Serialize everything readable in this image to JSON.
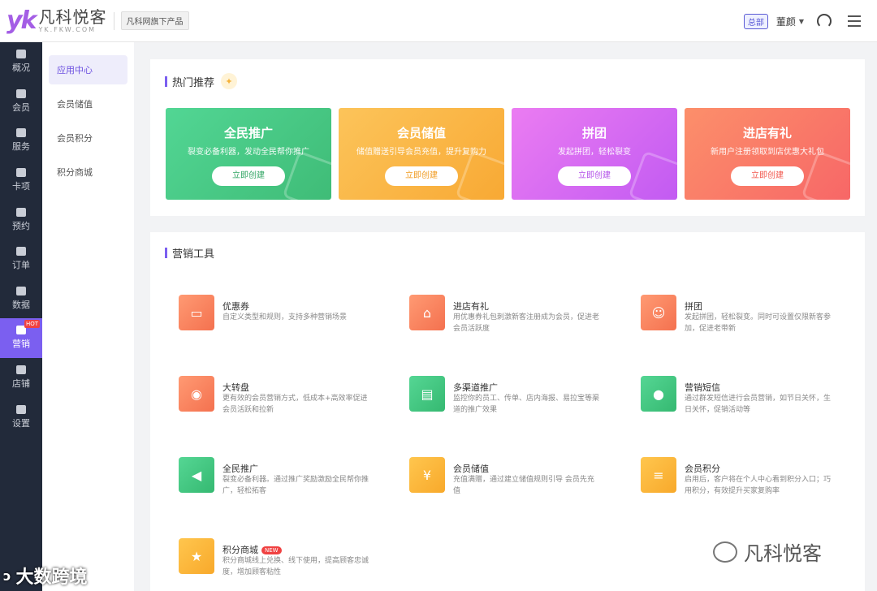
{
  "header": {
    "logo_mark": "yk",
    "logo_name": "凡科悦客",
    "logo_url": "YK.FKW.COM",
    "product_tag": "凡科网旗下产品",
    "store_badge": "总部",
    "user_name": "董颜"
  },
  "sidebar": {
    "items": [
      {
        "label": "概况"
      },
      {
        "label": "会员"
      },
      {
        "label": "服务"
      },
      {
        "label": "卡项"
      },
      {
        "label": "预约"
      },
      {
        "label": "订单"
      },
      {
        "label": "数据"
      },
      {
        "label": "营销",
        "badge": "HOT",
        "active": true
      },
      {
        "label": "店铺"
      },
      {
        "label": "设置"
      }
    ]
  },
  "subnav": {
    "items": [
      {
        "label": "应用中心",
        "active": true
      },
      {
        "label": "会员储值"
      },
      {
        "label": "会员积分"
      },
      {
        "label": "积分商城"
      }
    ]
  },
  "hot": {
    "title": "热门推荐",
    "cards": [
      {
        "title": "全民推广",
        "subtitle": "裂变必备利器，发动全民帮你推广",
        "button": "立即创建"
      },
      {
        "title": "会员储值",
        "subtitle": "储值赠送引导会员充值，提升复购力",
        "button": "立即创建"
      },
      {
        "title": "拼团",
        "subtitle": "发起拼团，轻松裂变",
        "button": "立即创建"
      },
      {
        "title": "进店有礼",
        "subtitle": "新用户注册领取到店优惠大礼包",
        "button": "立即创建"
      }
    ]
  },
  "tools": {
    "title": "营销工具",
    "items": [
      {
        "name": "优惠券",
        "desc": "自定义类型和规则，支持多种营销场景",
        "icon": "ticket-icon",
        "color": "#f4714f"
      },
      {
        "name": "进店有礼",
        "desc": "用优惠券礼包刺激新客注册成为会员，促进老会员活跃度",
        "icon": "gift-store-icon",
        "color": "#f4714f"
      },
      {
        "name": "拼团",
        "desc": "发起拼团，轻松裂变。同时可设置仅限新客参加，促进老带新",
        "icon": "group-icon",
        "color": "#f4714f"
      },
      {
        "name": "大转盘",
        "desc": "更有效的会员营销方式，低成本+高效率促进会员活跃和拉新",
        "icon": "wheel-icon",
        "color": "#f4714f"
      },
      {
        "name": "多渠道推广",
        "desc": "监控你的员工、传单、店内海报、易拉宝等渠道的推广效果",
        "icon": "channel-icon",
        "color": "#35b971"
      },
      {
        "name": "营销短信",
        "desc": "通过群发短信进行会员营销，如节日关怀，生日关怀，促销活动等",
        "icon": "sms-icon",
        "color": "#35b971"
      },
      {
        "name": "全民推广",
        "desc": "裂变必备利器。通过推广奖励激励全民帮你推广，轻松拓客",
        "icon": "megaphone-icon",
        "color": "#35b971"
      },
      {
        "name": "会员储值",
        "desc": "充值满赠，通过建立储值规则引导 会员先充值",
        "icon": "yen-coin-icon",
        "color": "#f8a92b"
      },
      {
        "name": "会员积分",
        "desc": "启用后，客户将在个人中心看到积分入口；巧用积分，有效提升买家复购率",
        "icon": "points-icon",
        "color": "#f8a92b"
      },
      {
        "name": "积分商城",
        "badge": "NEW",
        "desc": "积分商城线上兑换、线下使用，提高顾客忠诚度，增加顾客粘性",
        "icon": "shop-bag-icon",
        "color": "#f8a92b"
      }
    ]
  },
  "watermark": {
    "text": "凡科悦客",
    "bottom_left": "大数跨境"
  }
}
